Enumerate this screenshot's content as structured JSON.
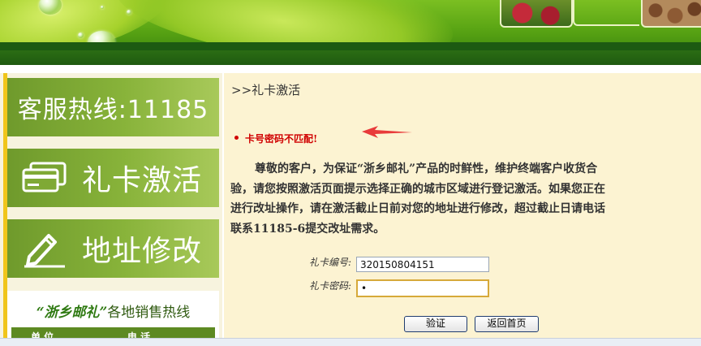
{
  "sidebar": {
    "hotline_label": "客服热线:11185",
    "activate_label": "礼卡激活",
    "address_label": "地址修改",
    "sales_hotline": {
      "brand": "“浙乡邮礼”",
      "title_suffix": "各地销售热线",
      "col_unit": "单 位",
      "col_phone": "电 话"
    }
  },
  "main": {
    "breadcrumb": ">>礼卡激活",
    "error_message": "卡号密码不匹配!",
    "notice_lines": [
      "尊敬的客户，为保证“浙乡邮礼”产品的时鲜性，维护终端客户收货合",
      "验，请您按照激活页面提示选择正确的城市区域进行登记激活。如果您正在",
      "进行改址操作，请在激活截止日前对您的地址进行修改，超过截止日请电话",
      "联系11185-6提交改址需求。"
    ],
    "form": {
      "card_number_label": "礼卡编号:",
      "card_number_value": "320150804151",
      "card_password_label": "礼卡密码:",
      "card_password_value": "•"
    },
    "buttons": {
      "verify": "验证",
      "back_home": "返回首页"
    }
  },
  "colors": {
    "sidebar_green": "#88b33a",
    "content_bg": "#fcf3d2",
    "error_red": "#d00000",
    "accent_yellow": "#f0c51a"
  }
}
